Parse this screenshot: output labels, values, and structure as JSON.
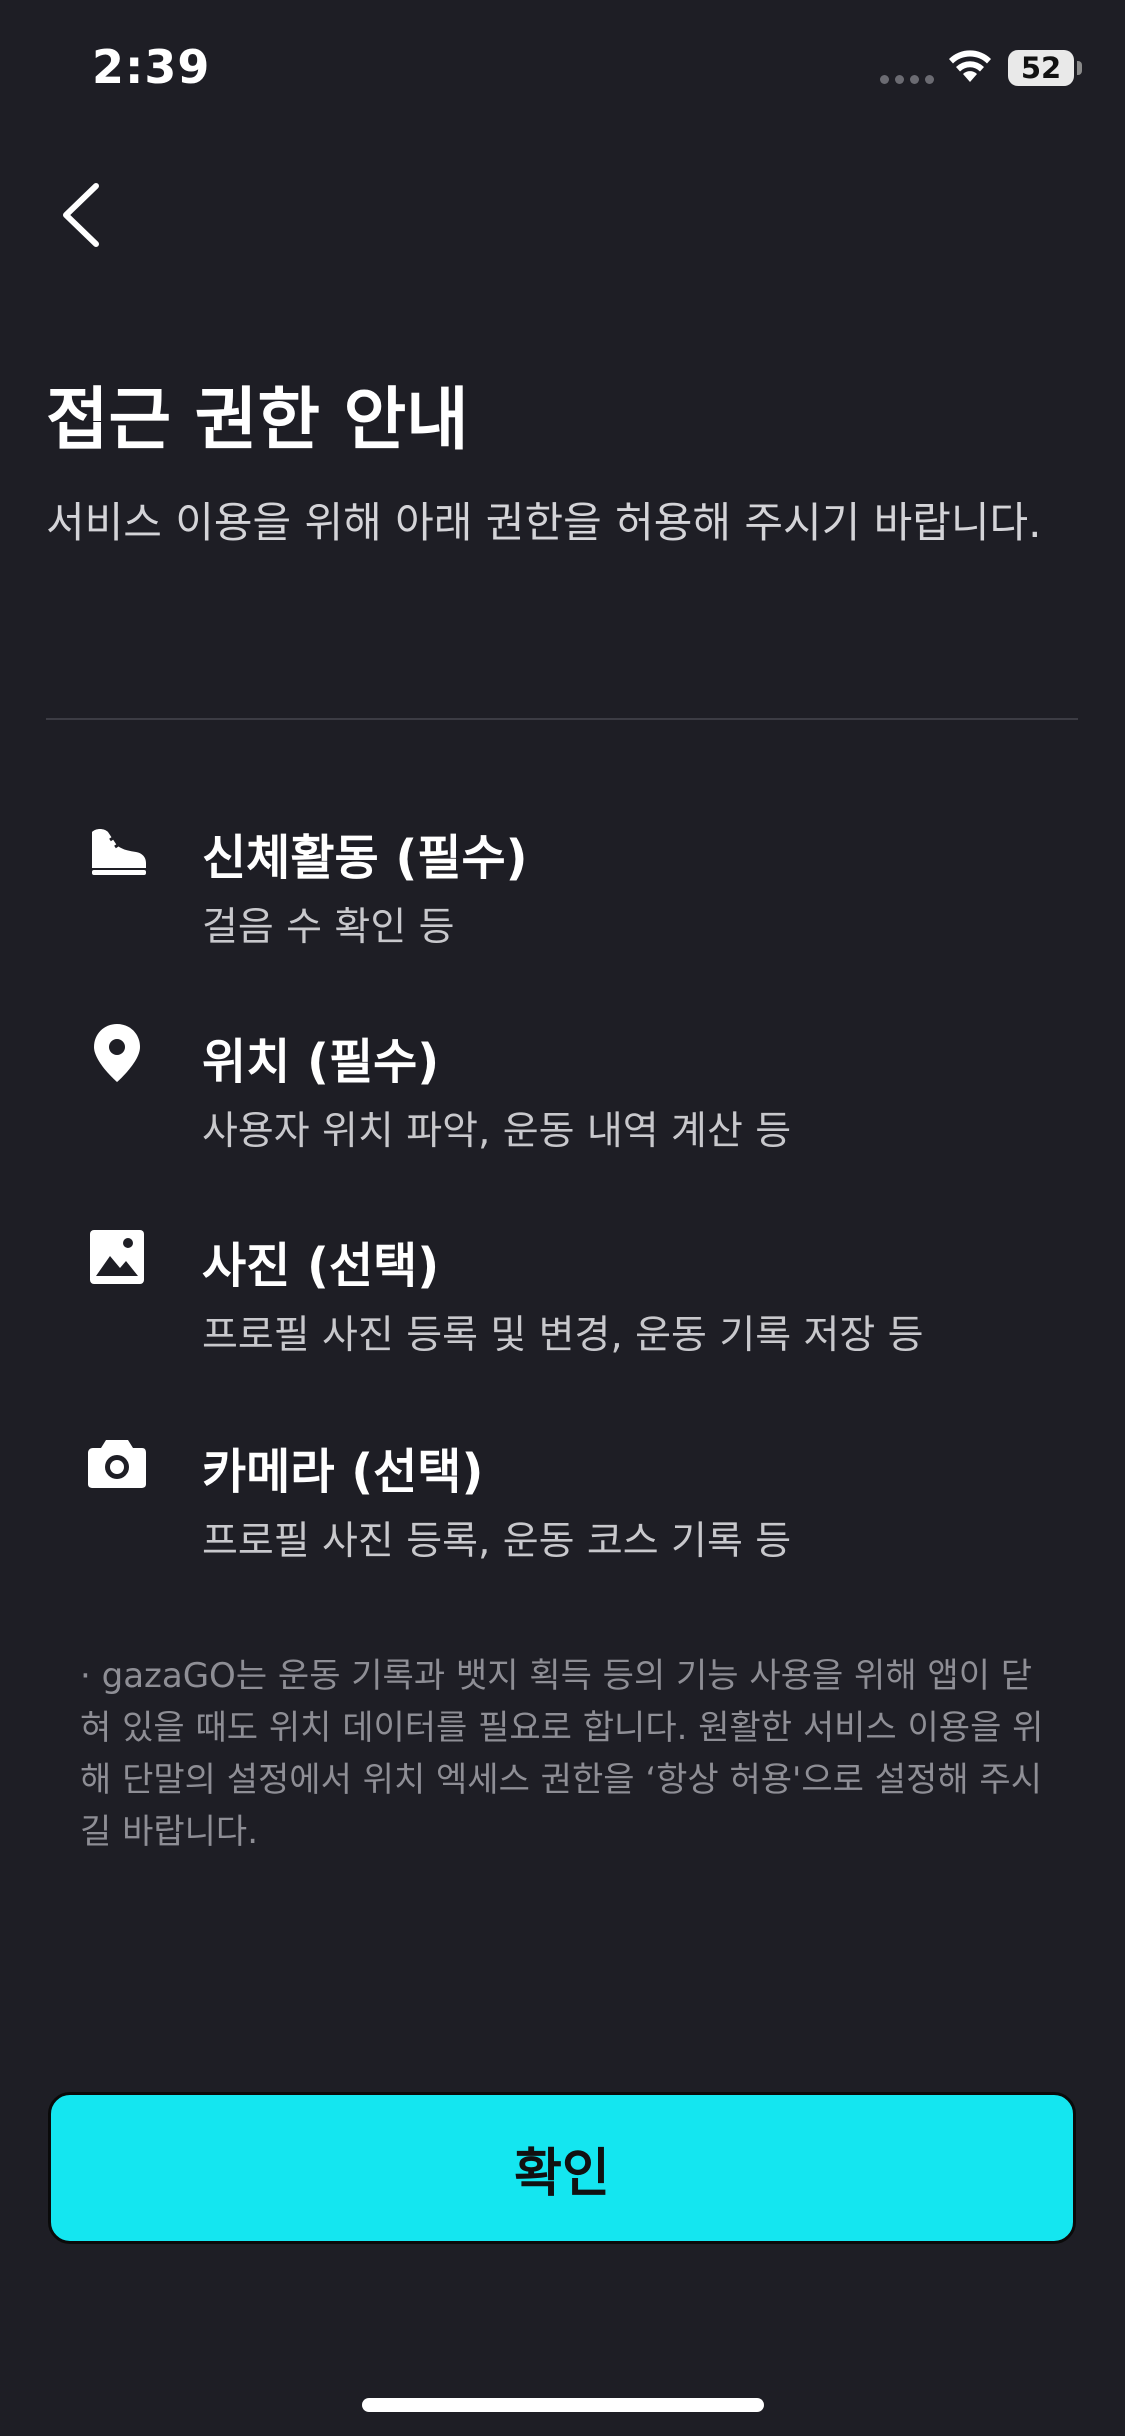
{
  "status_bar": {
    "time": "2:39",
    "battery": "52"
  },
  "header": {
    "title": "접근 권한 안내",
    "subtitle": "서비스 이용을 위해 아래 권한을 허용해 주시기 바랍니다."
  },
  "permissions": [
    {
      "icon": "sneaker-icon",
      "title": "신체활동 (필수)",
      "description": "걸음 수 확인 등"
    },
    {
      "icon": "location-pin-icon",
      "title": "위치 (필수)",
      "description": "사용자 위치 파악, 운동 내역 계산 등"
    },
    {
      "icon": "photo-icon",
      "title": "사진 (선택)",
      "description": "프로필 사진 등록 및 변경, 운동 기록 저장 등"
    },
    {
      "icon": "camera-icon",
      "title": "카메라 (선택)",
      "description": "프로필 사진 등록, 운동 코스 기록 등"
    }
  ],
  "notice": "· gazaGO는 운동 기록과 뱃지 획득 등의 기능 사용을 위해 앱이 닫혀 있을 때도 위치 데이터를 필요로 합니다. 원활한 서비스 이용을 위해 단말의 설정에서 위치 엑세스  권한을 ‘항상 허용'으로 설정해 주시길 바랍니다.",
  "confirm_label": "확인",
  "colors": {
    "background": "#1e1e25",
    "accent": "#14e6f0"
  }
}
